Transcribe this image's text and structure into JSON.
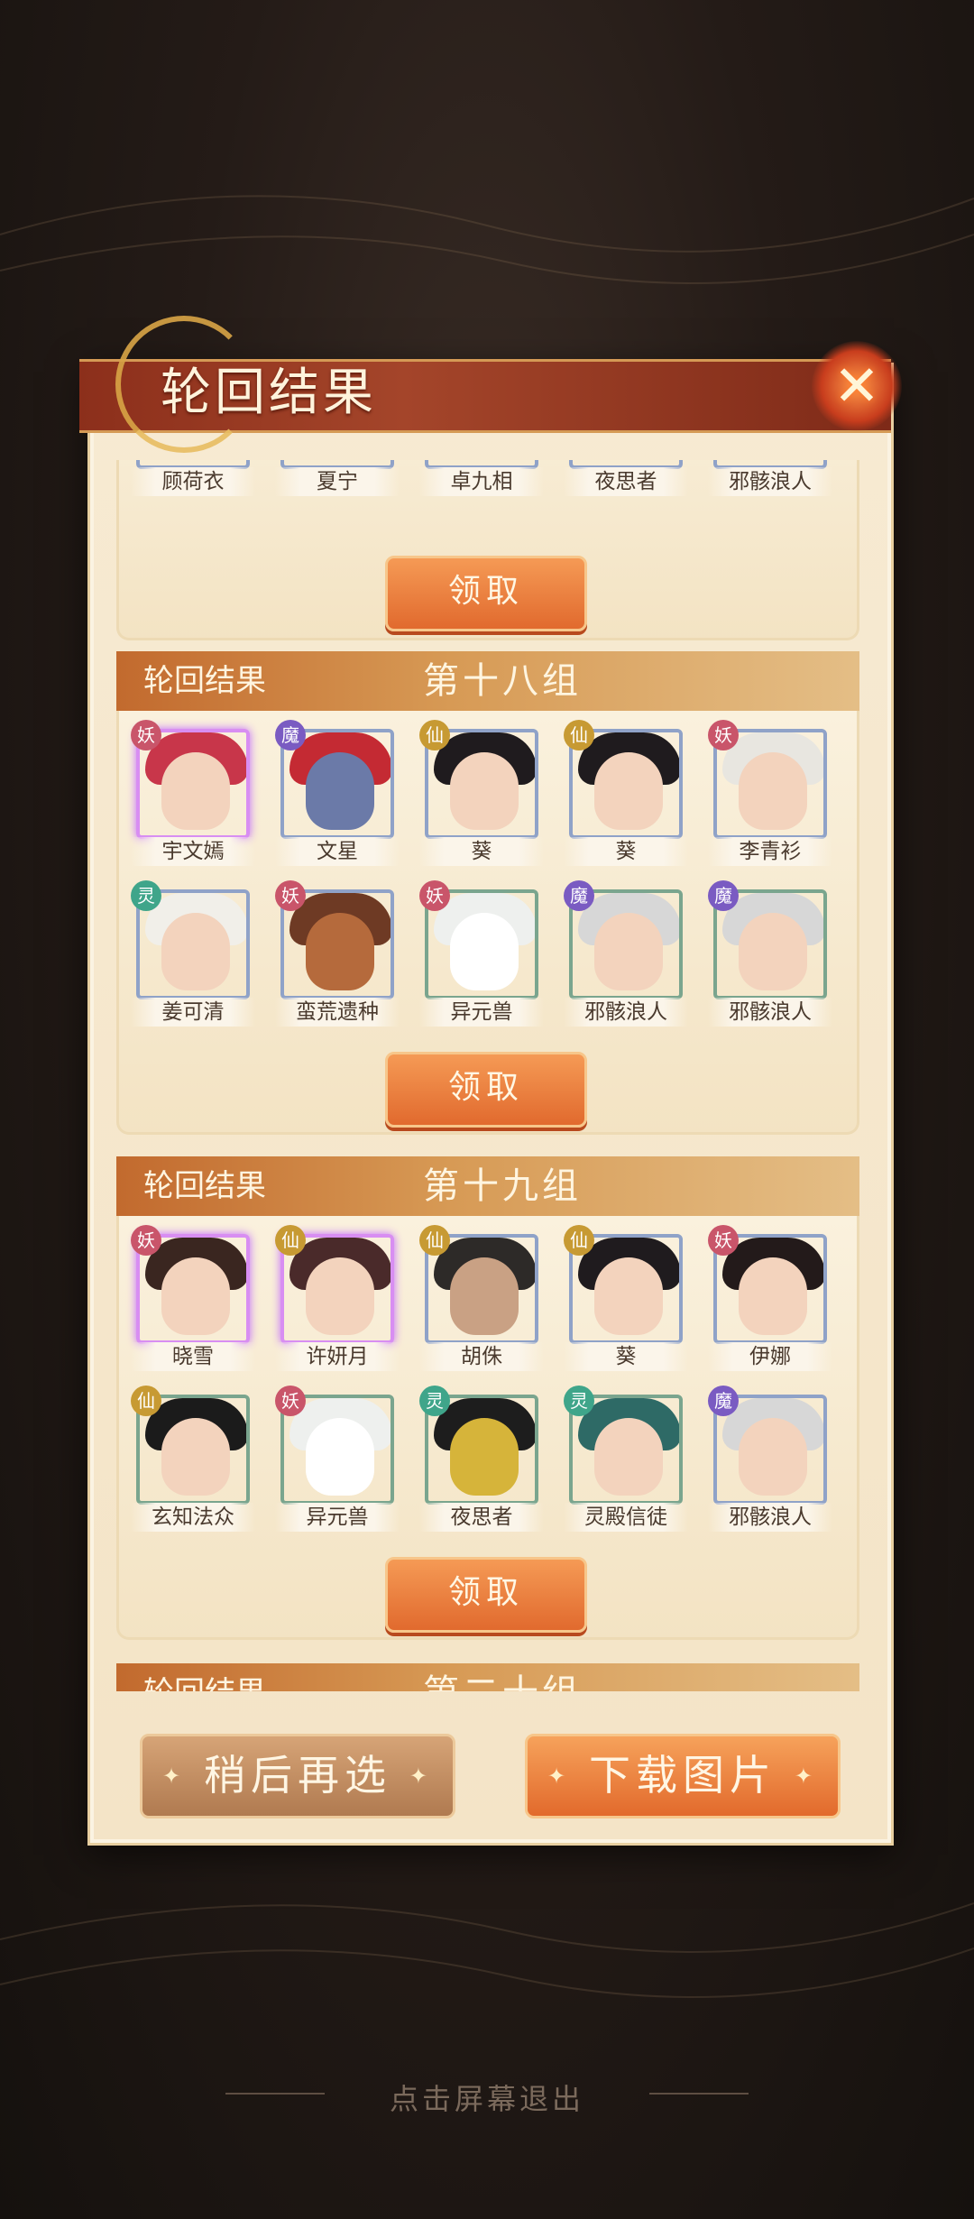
{
  "title": "轮回结果",
  "close_icon": "close-x-icon",
  "partial_group": {
    "names": [
      "顾荷衣",
      "夏宁",
      "卓九相",
      "夜思者",
      "邪骸浪人"
    ],
    "claim_label": "领取"
  },
  "groups": [
    {
      "label": "轮回结果",
      "number": "第十八组",
      "row1": [
        {
          "name": "宇文嫣",
          "badge": "妖"
        },
        {
          "name": "文星",
          "badge": "魔"
        },
        {
          "name": "葵",
          "badge": "仙"
        },
        {
          "name": "葵",
          "badge": "仙"
        },
        {
          "name": "李青衫",
          "badge": "妖"
        }
      ],
      "row2": [
        {
          "name": "姜可清",
          "badge": "灵"
        },
        {
          "name": "蛮荒遗种",
          "badge": "妖"
        },
        {
          "name": "异元兽",
          "badge": "妖"
        },
        {
          "name": "邪骸浪人",
          "badge": "魔"
        },
        {
          "name": "邪骸浪人",
          "badge": "魔"
        }
      ],
      "claim_label": "领取"
    },
    {
      "label": "轮回结果",
      "number": "第十九组",
      "row1": [
        {
          "name": "晓雪",
          "badge": "妖"
        },
        {
          "name": "许妍月",
          "badge": "仙"
        },
        {
          "name": "胡侏",
          "badge": "仙"
        },
        {
          "name": "葵",
          "badge": "仙"
        },
        {
          "name": "伊娜",
          "badge": "妖"
        }
      ],
      "row2": [
        {
          "name": "玄知法众",
          "badge": "仙"
        },
        {
          "name": "异元兽",
          "badge": "妖"
        },
        {
          "name": "夜思者",
          "badge": "灵"
        },
        {
          "name": "灵殿信徒",
          "badge": "灵"
        },
        {
          "name": "邪骸浪人",
          "badge": "魔"
        }
      ],
      "claim_label": "领取"
    },
    {
      "label": "轮回结果",
      "number": "第二十组"
    }
  ],
  "buttons": {
    "later": "稍后再选",
    "download": "下载图片"
  },
  "exit_hint": "点击屏幕退出"
}
